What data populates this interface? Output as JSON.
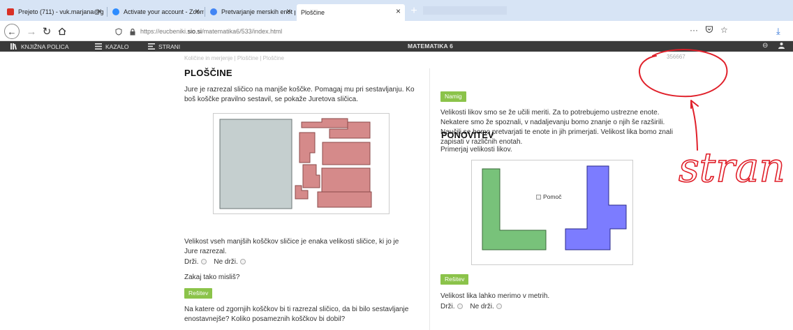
{
  "browser": {
    "tabs": [
      {
        "title": "Prejeto (711) - vuk.marjana@g",
        "fav_color": "#d93025"
      },
      {
        "title": "Activate your account - Zoom",
        "fav_color": "#2d8cff"
      },
      {
        "title": "Pretvarjanje merskih enot pdf",
        "fav_color": "#4285f4"
      },
      {
        "title": "Ploščine",
        "fav_color": "#ffffff"
      }
    ],
    "new_tab_label": "+",
    "url_prefix": "https://eucbeniki.",
    "url_domain": "sio.si",
    "url_suffix": "/matematika6/533/index.html"
  },
  "app_toolbar": {
    "bookshelf_label": "KNJIŽNA POLICA",
    "contents_label": "KAZALO",
    "pages_label": "STRANI",
    "title": "MATEMATIKA 6"
  },
  "page": {
    "breadcrumb": "Količine in merjenje | Ploščine | Ploščine",
    "page_number": "356667",
    "title": "PLOŠČINE",
    "intro": "Jure je razrezal sličico na manjše koščke. Pomagaj mu pri sestavljanju. Ko boš koščke pravilno sestavil, se pokaže Juretova sličica.",
    "question1": "Velikost vseh manjših koščkov sličice je enaka velikosti sličice, ki jo je Jure razrezal.",
    "option_true": "Drži.",
    "option_false": "Ne drži.",
    "why": "Zakaj tako misliš?",
    "solution_label": "Rešitev",
    "question2": "Na katere od zgornjih koščkov bi ti razrezal sličico, da bi bilo sestavljanje enostavnejše? Koliko posameznih koščkov bi dobil?"
  },
  "right": {
    "hint_label": "Namig",
    "hint_text": "Velikosti likov smo se že učili meriti. Za to potrebujemo ustrezne enote. Nekatere smo že spoznali, v nadaljevanju bomo znanje o njih še razširili. Naučili se bomo pretvarjati te enote in jih primerjati. Velikost lika bomo znali zapisati v različnih enotah.",
    "subtitle": "PONOVITEV",
    "compare_text": "Primerjaj velikosti likov.",
    "help_label": "Pomoč",
    "solution_label": "Rešitev",
    "statement": "Velikost lika lahko merimo v metrih.",
    "option_true": "Drži.",
    "option_false": "Ne drži."
  },
  "annotation": {
    "handwritten_text": "stran",
    "color": "#e0202a"
  },
  "colors": {
    "green_button": "#8bc34a",
    "gray_piece": "#c5cfcf",
    "pink_piece": "#d58a8a",
    "green_shape": "#78c27a",
    "blue_shape": "#7c7cff"
  }
}
